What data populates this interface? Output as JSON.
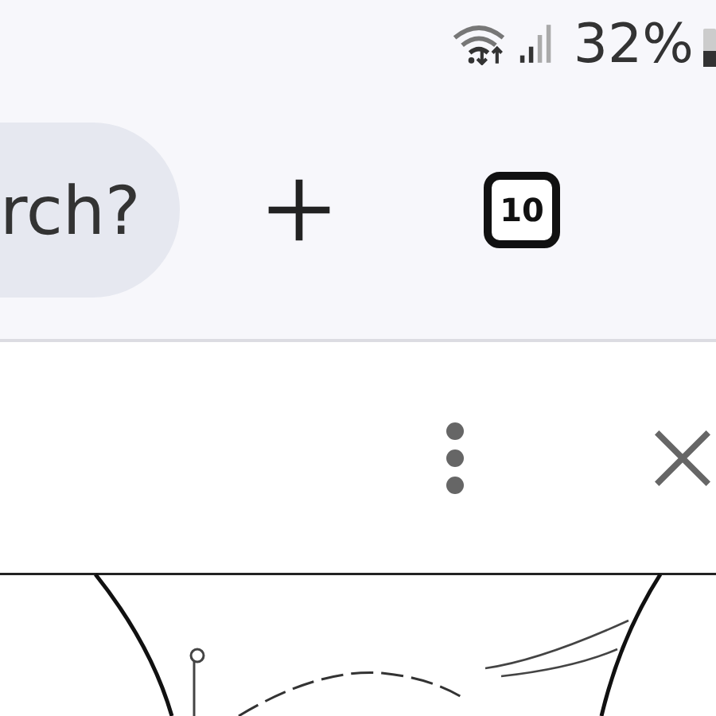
{
  "status_bar": {
    "battery": "32%"
  },
  "toolbar": {
    "search": {
      "value": "rch?"
    },
    "tab_count": "10"
  }
}
